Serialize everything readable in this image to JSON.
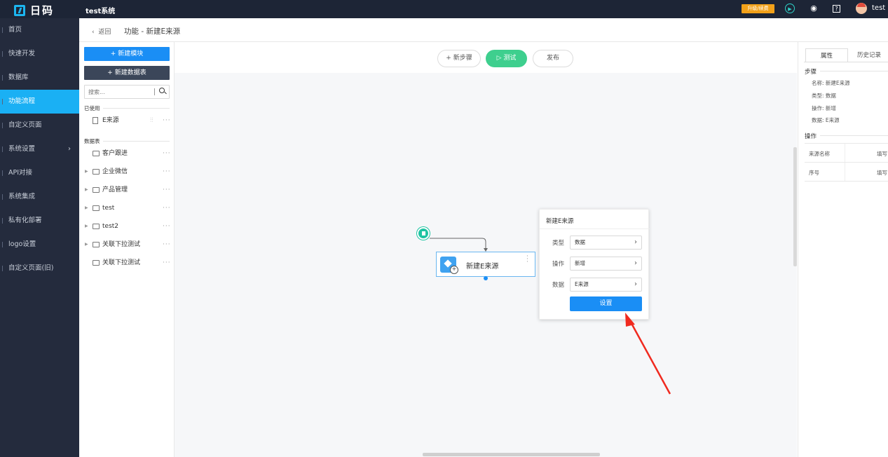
{
  "topbar": {
    "logo_text": "日码",
    "system_name": "test系统",
    "upgrade_badge": "升级/续费",
    "username": "test"
  },
  "sidebar": {
    "items": [
      {
        "label": "首页"
      },
      {
        "label": "快速开发"
      },
      {
        "label": "数据库"
      },
      {
        "label": "功能流程"
      },
      {
        "label": "自定义页面"
      },
      {
        "label": "系统设置"
      },
      {
        "label": "API对接"
      },
      {
        "label": "系统集成"
      },
      {
        "label": "私有化部署"
      },
      {
        "label": "logo设置"
      },
      {
        "label": "自定义页面(旧)"
      }
    ],
    "active_index": 3
  },
  "breadcrumb": {
    "back": "返回",
    "title": "功能 - 新建E来源"
  },
  "left_panel": {
    "new_module": "+ 新建模块",
    "new_table": "+ 新建数据表",
    "search_placeholder": "搜索...",
    "used_label": "已使用",
    "used_items": [
      {
        "label": "E来源"
      }
    ],
    "tables_label": "数据表",
    "tables": [
      {
        "label": "客户跟进"
      },
      {
        "label": "企业微信"
      },
      {
        "label": "产品管理"
      },
      {
        "label": "test"
      },
      {
        "label": "test2"
      },
      {
        "label": "关联下拉测试"
      },
      {
        "label": "关联下拉测试"
      }
    ]
  },
  "toolbar": {
    "new_step": "+ 新步骤",
    "test": "▷ 测试",
    "publish": "发布"
  },
  "node": {
    "label": "新建E来源"
  },
  "popup": {
    "title": "新建E来源",
    "fields": [
      {
        "label": "类型",
        "value": "数据"
      },
      {
        "label": "操作",
        "value": "新增"
      },
      {
        "label": "数据",
        "value": "E来源"
      }
    ],
    "button": "设置"
  },
  "right_panel": {
    "tabs": [
      "属性",
      "历史记录"
    ],
    "step_label": "步骤",
    "step_info": [
      "名称: 新建E来源",
      "类型: 数据",
      "操作: 新增",
      "数据: E来源"
    ],
    "op_label": "操作",
    "op_rows": [
      {
        "key": "来源名称",
        "value": "填写"
      },
      {
        "key": "序号",
        "value": "填写"
      }
    ]
  },
  "colors": {
    "accent": "#1a8ef5",
    "sidebar_bg": "#242b3d",
    "active_nav": "#1ab0f4",
    "test_button": "#3ecf8e",
    "annotation_arrow": "#f02a1f"
  }
}
